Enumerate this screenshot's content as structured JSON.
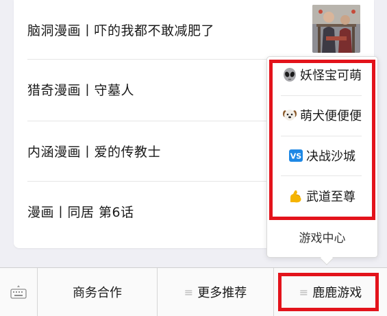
{
  "articles": [
    {
      "title": "脑洞漫画丨吓的我都不敢减肥了"
    },
    {
      "title": "猎奇漫画丨守墓人"
    },
    {
      "title": "内涵漫画丨爱的传教士"
    },
    {
      "title": "漫画丨同居 第6话"
    }
  ],
  "popup_menu": {
    "items": [
      {
        "label": "妖怪宝可萌",
        "icon": "alien-icon"
      },
      {
        "label": "萌犬便便便",
        "icon": "dog-icon"
      },
      {
        "label": "决战沙城",
        "icon": "vs-icon"
      },
      {
        "label": "武道至尊",
        "icon": "flexed-biceps-icon"
      }
    ],
    "footer": "游戏中心"
  },
  "bottom_bar": {
    "keyboard_icon": "keyboard-icon",
    "tabs": [
      {
        "label": "商务合作",
        "has_menu": false
      },
      {
        "label": "更多推荐",
        "has_menu": true
      },
      {
        "label": "鹿鹿游戏",
        "has_menu": true
      }
    ],
    "menu_glyph": "≡"
  },
  "colors": {
    "highlight": "#e3131b",
    "background": "#efeff4",
    "card": "#ffffff",
    "vs_badge": "#1e88e5",
    "biceps": "#f5b400"
  }
}
